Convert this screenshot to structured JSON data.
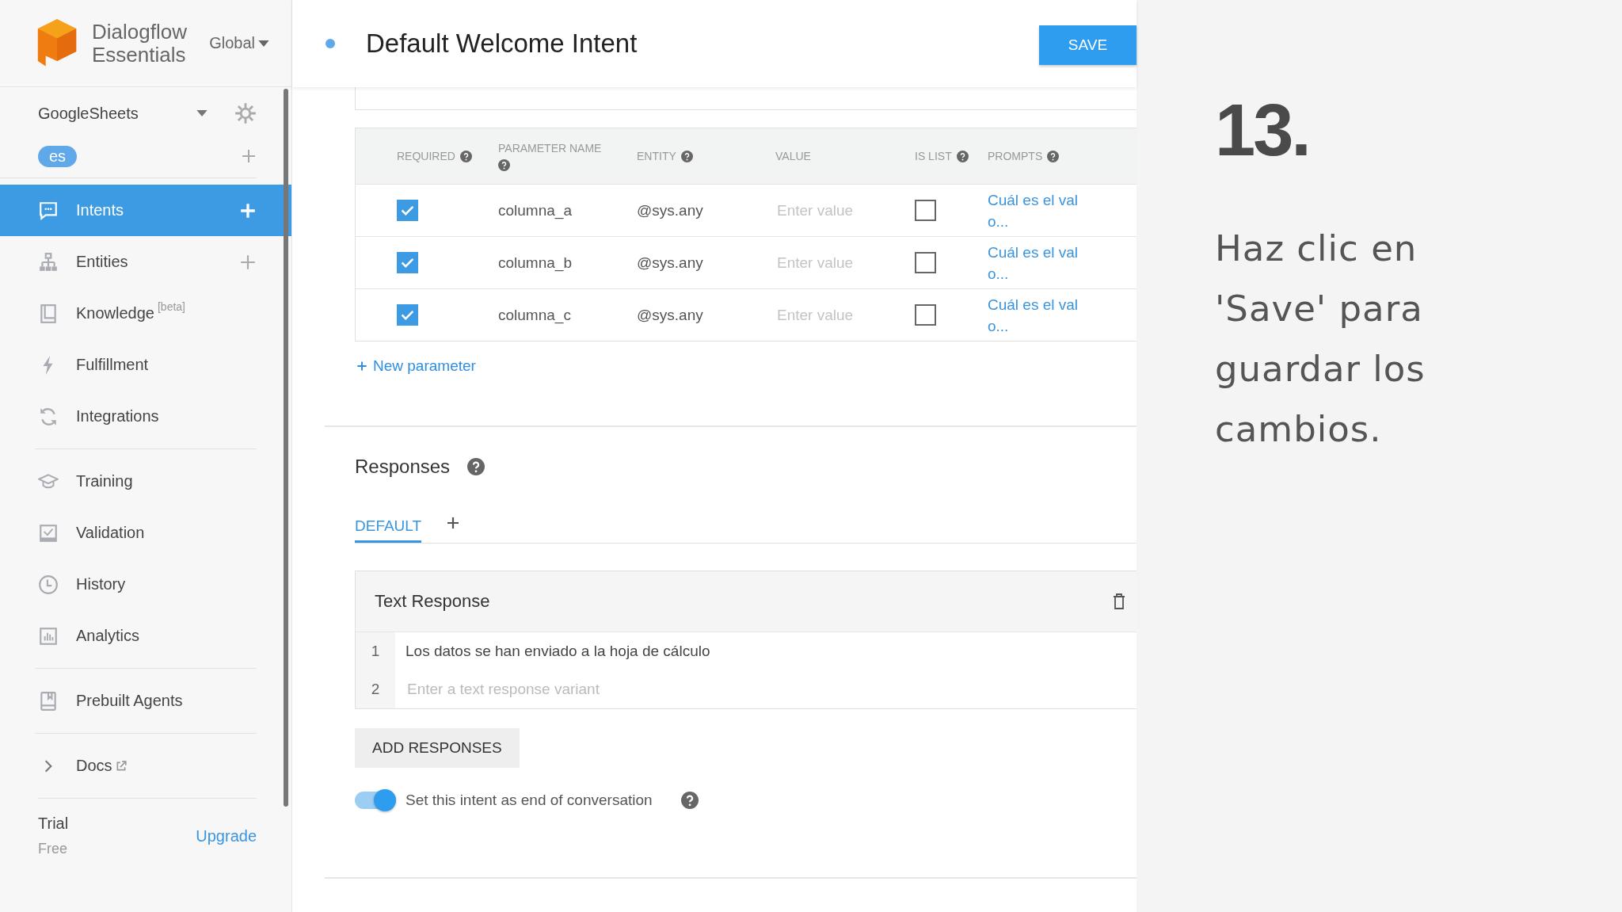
{
  "sidebar": {
    "brand": [
      "Dialogflow",
      "Essentials"
    ],
    "region": "Global",
    "agent": "GoogleSheets",
    "language": "es",
    "sections": [
      [
        {
          "label": "Intents",
          "kind": "chat",
          "selected": true,
          "addable": true
        },
        {
          "label": "Entities",
          "kind": "hierarchy",
          "selected": false,
          "addable": true
        },
        {
          "label": "Knowledge",
          "badge": "[beta]",
          "kind": "book",
          "selected": false,
          "addable": false
        },
        {
          "label": "Fulfillment",
          "kind": "bolt",
          "selected": false,
          "addable": false
        },
        {
          "label": "Integrations",
          "kind": "sync",
          "selected": false,
          "addable": false
        }
      ],
      [
        {
          "label": "Training",
          "kind": "cap",
          "selected": false,
          "addable": false
        },
        {
          "label": "Validation",
          "kind": "check",
          "selected": false,
          "addable": false
        },
        {
          "label": "History",
          "kind": "clock",
          "selected": false,
          "addable": false
        },
        {
          "label": "Analytics",
          "kind": "bars",
          "selected": false,
          "addable": false
        }
      ],
      [
        {
          "label": "Prebuilt Agents",
          "kind": "bookmark",
          "selected": false,
          "addable": false
        }
      ],
      [
        {
          "label": "Docs",
          "kind": "chevron",
          "external": true,
          "selected": false,
          "addable": false
        }
      ]
    ],
    "plan": "Trial",
    "plan_detail": "Free",
    "upgrade": "Upgrade"
  },
  "header": {
    "title": "Default Welcome Intent",
    "save": "SAVE"
  },
  "parameters": {
    "columns": [
      {
        "label": "REQUIRED",
        "help": true
      },
      {
        "label": "PARAMETER NAME",
        "help": true
      },
      {
        "label": "ENTITY",
        "help": true
      },
      {
        "label": "VALUE",
        "help": false
      },
      {
        "label": "IS LIST",
        "help": true
      },
      {
        "label": "PROMPTS",
        "help": true
      }
    ],
    "rows": [
      {
        "required": true,
        "name": "columna_a",
        "entity": "@sys.any",
        "value_placeholder": "Enter value",
        "is_list": false,
        "prompt": "Cuál es el valo..."
      },
      {
        "required": true,
        "name": "columna_b",
        "entity": "@sys.any",
        "value_placeholder": "Enter value",
        "is_list": false,
        "prompt": "Cuál es el valo..."
      },
      {
        "required": true,
        "name": "columna_c",
        "entity": "@sys.any",
        "value_placeholder": "Enter value",
        "is_list": false,
        "prompt": "Cuál es el valo..."
      }
    ],
    "add": "New parameter"
  },
  "responses": {
    "title": "Responses",
    "tabs": [
      {
        "label": "DEFAULT",
        "selected": true
      }
    ],
    "card": {
      "title": "Text Response",
      "rows": [
        {
          "number": "1",
          "text": "Los datos se han enviado a la hoja de cálculo"
        },
        {
          "number": "2",
          "placeholder": "Enter a text response variant"
        }
      ]
    },
    "add_button": "ADD RESPONSES",
    "end_conversation": {
      "label": "Set this intent as end of conversation",
      "on": true
    }
  },
  "overlay": {
    "step": "13.",
    "text": "Haz clic en 'Save' para guardar los cambios."
  }
}
